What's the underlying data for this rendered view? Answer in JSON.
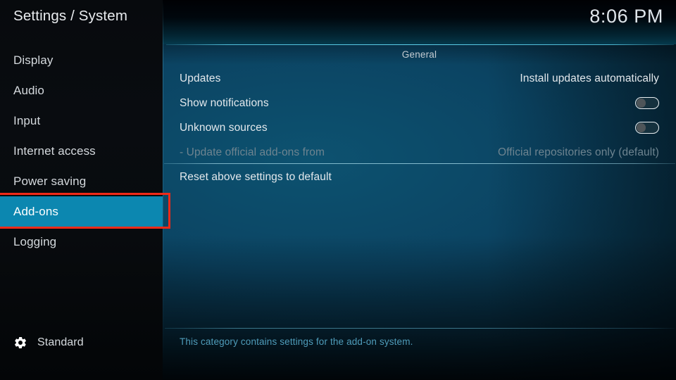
{
  "header": {
    "title": "Settings / System",
    "clock": "8:06 PM"
  },
  "sidebar": {
    "items": [
      {
        "label": "Display",
        "selected": false
      },
      {
        "label": "Audio",
        "selected": false
      },
      {
        "label": "Input",
        "selected": false
      },
      {
        "label": "Internet access",
        "selected": false
      },
      {
        "label": "Power saving",
        "selected": false
      },
      {
        "label": "Add-ons",
        "selected": true
      },
      {
        "label": "Logging",
        "selected": false
      }
    ],
    "profile": {
      "icon": "gear-icon",
      "label": "Standard"
    }
  },
  "content": {
    "section_header": "General",
    "rows": [
      {
        "label": "Updates",
        "type": "value",
        "value": "Install updates automatically",
        "dim": false
      },
      {
        "label": "Show notifications",
        "type": "toggle",
        "value": "off",
        "dim": false
      },
      {
        "label": "Unknown sources",
        "type": "toggle",
        "value": "off",
        "dim": false
      },
      {
        "label": "- Update official add-ons from",
        "type": "value",
        "value": "Official repositories only (default)",
        "dim": true
      },
      {
        "label": "Reset above settings to default",
        "type": "action",
        "value": "",
        "dim": false
      }
    ],
    "description": "This category contains settings for the add-on system."
  },
  "annotation": {
    "target": "Add-ons",
    "color": "#ef2a18"
  },
  "colors": {
    "highlight": "#0c87b0",
    "annotation": "#ef2a18",
    "description_text": "#4f9cba",
    "panel_teal": "#0b4463"
  }
}
